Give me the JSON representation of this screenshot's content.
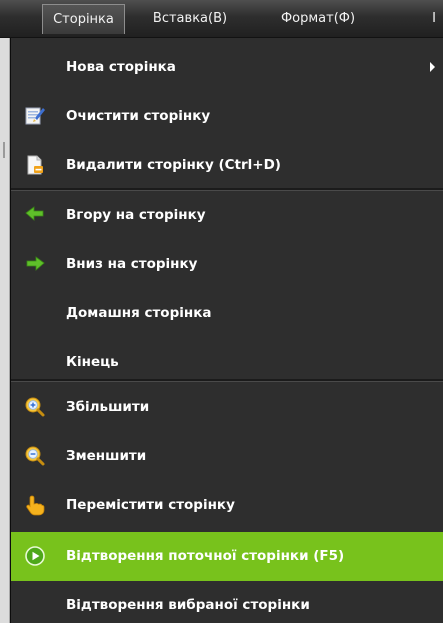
{
  "menubar": {
    "items": [
      {
        "label": "Сторінка"
      },
      {
        "label": "Вставка(В)"
      },
      {
        "label": "Формат(Ф)"
      },
      {
        "label": "I"
      }
    ]
  },
  "menu": {
    "items": [
      {
        "label": "Нова сторінка",
        "icon": "none",
        "has_submenu": true
      },
      {
        "label": "Очистити сторінку",
        "icon": "clear-page-icon"
      },
      {
        "label": "Видалити сторінку (Ctrl+D)",
        "icon": "delete-page-icon"
      },
      {
        "label": "Вгору на сторінку",
        "icon": "arrow-left-icon"
      },
      {
        "label": "Вниз на сторінку",
        "icon": "arrow-right-icon"
      },
      {
        "label": "Домашня сторінка",
        "icon": "none"
      },
      {
        "label": "Кінець",
        "icon": "none"
      },
      {
        "label": "Збільшити",
        "icon": "zoom-in-icon"
      },
      {
        "label": "Зменшити",
        "icon": "zoom-out-icon"
      },
      {
        "label": "Перемістити сторінку",
        "icon": "hand-pointer-icon"
      },
      {
        "label": "Відтворення поточної сторінки (F5)",
        "icon": "play-icon",
        "highlighted": true
      },
      {
        "label": "Відтворення вибраної сторінки",
        "icon": "none"
      }
    ]
  },
  "colors": {
    "menu_background": "#2e2e2e",
    "highlight": "#78c21c",
    "text": "#ffffff"
  }
}
